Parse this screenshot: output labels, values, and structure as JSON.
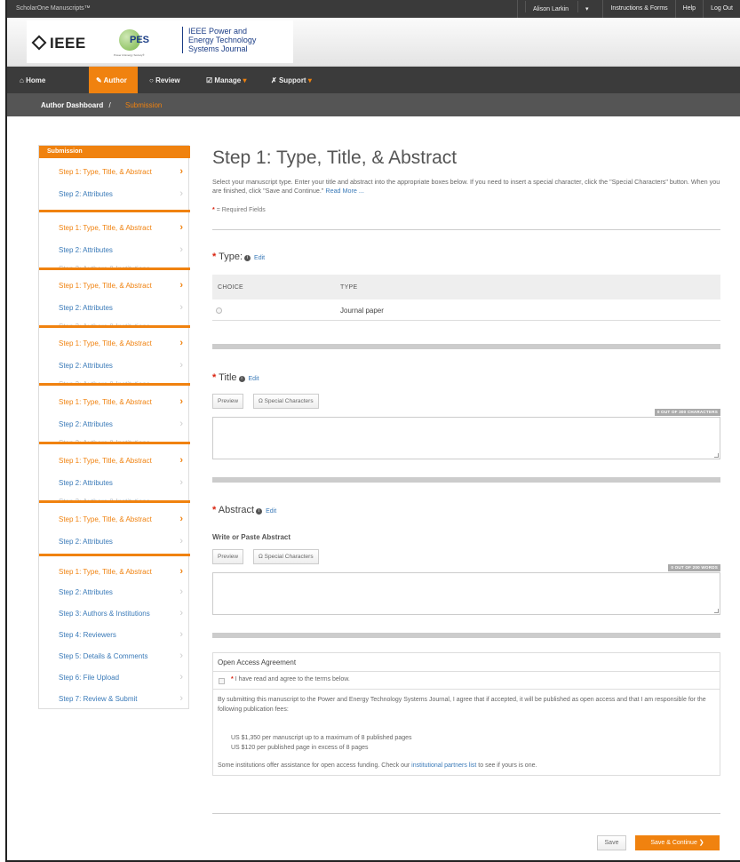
{
  "topbar": {
    "brand": "ScholarOne Manuscripts™",
    "user": "Alison Larkin",
    "links": [
      "Instructions & Forms",
      "Help",
      "Log Out"
    ]
  },
  "logo": {
    "ieee": "IEEE",
    "pes": "PES",
    "pes_tagline": "Power & Energy Society®",
    "journal_lines": [
      "IEEE Power and",
      "Energy Technology",
      "Systems Journal"
    ]
  },
  "nav": {
    "home": "Home",
    "author": "Author",
    "review": "Review",
    "manage": "Manage",
    "support": "Support"
  },
  "breadcrumb": {
    "dashboard": "Author Dashboard",
    "sep": "/",
    "current": "Submission"
  },
  "sidebar": {
    "heading": "Submission",
    "step1": "Step 1: Type, Title, & Abstract",
    "step2": "Step 2: Attributes",
    "step3": "Step 3: Authors & Institutions",
    "step4": "Step 4: Reviewers",
    "step5": "Step 5: Details & Comments",
    "step6": "Step 6: File Upload",
    "step7": "Step 7: Review & Submit",
    "ghost": "Step 3: Authors & Institutions"
  },
  "main": {
    "title": "Step 1: Type, Title, & Abstract",
    "intro": "Select your manuscript type. Enter your title and abstract into the appropriate boxes below. If you need to insert a special character, click the \"Special Characters\" button. When you are finished, click \"Save and Continue.\"",
    "read_more": "Read More ...",
    "required": "= Required Fields",
    "type_label": "Type:",
    "edit": "Edit",
    "col_choice": "CHOICE",
    "col_type": "TYPE",
    "type_option": "Journal paper",
    "title_label": "Title",
    "preview": "Preview",
    "special_chars": "Ω Special Characters",
    "title_counter": "0 OUT OF 300 CHARACTERS",
    "abstract_label": "Abstract",
    "abstract_sub": "Write or Paste Abstract",
    "abstract_counter": "0 OUT OF 200 WORDS"
  },
  "open_access": {
    "heading": "Open Access Agreement",
    "agree": "I have read and agree to the terms below.",
    "para1": "By submitting this manuscript to the Power and Energy Technology Systems Journal, I agree that if accepted, it will be published as open access and that I am responsible for the following publication fees:",
    "fee1": "US $1,350 per manuscript up to a maximum of 8 published pages",
    "fee2": "US $120 per published page in excess of 8 pages",
    "para2": "Some institutions offer assistance for open access funding. Check our",
    "link": "institutional partners list",
    "para2_end": "to see if yours is one."
  },
  "actions": {
    "save": "Save",
    "save_continue": "Save & Continue ❯"
  },
  "colors": {
    "accent": "#f0820f",
    "link": "#3a7ab8",
    "topbar": "#3a3a3a"
  }
}
